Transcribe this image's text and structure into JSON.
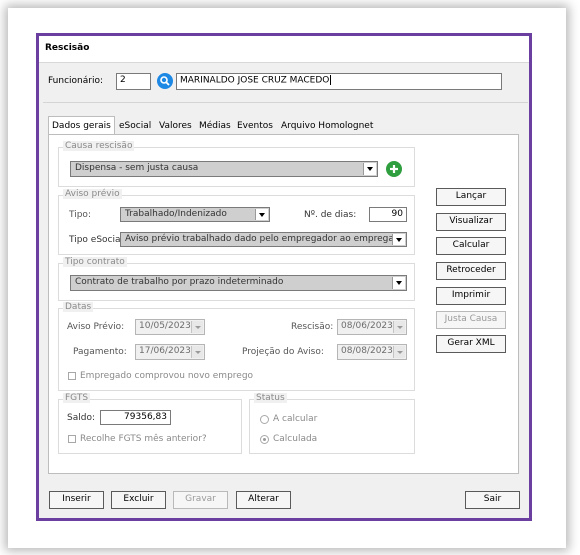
{
  "window": {
    "title": "Rescisão"
  },
  "funcionario": {
    "label": "Funcionário:",
    "code": "2",
    "name": "MARINALDO JOSE CRUZ MACEDO"
  },
  "tabs": [
    {
      "label": "Dados gerais",
      "active": true
    },
    {
      "label": "eSocial"
    },
    {
      "label": "Valores"
    },
    {
      "label": "Médias"
    },
    {
      "label": "Eventos"
    },
    {
      "label": "Arquivo Homolognet"
    }
  ],
  "causa": {
    "group_title": "Causa rescisão",
    "value": "Dispensa - sem justa causa"
  },
  "aviso": {
    "group_title": "Aviso prévio",
    "tipo_label": "Tipo:",
    "tipo_value": "Trabalhado/Indenizado",
    "dias_label": "Nº. de dias:",
    "dias_value": "90",
    "esocial_label": "Tipo eSocial:",
    "esocial_value": "Aviso prévio trabalhado dado pelo empregador ao empregado, ..."
  },
  "contrato": {
    "group_title": "Tipo contrato",
    "value": "Contrato de trabalho por prazo indeterminado"
  },
  "datas": {
    "group_title": "Datas",
    "aviso_label": "Aviso Prévio:",
    "aviso_value": "10/05/2023",
    "rescisao_label": "Rescisão:",
    "rescisao_value": "08/06/2023",
    "pagamento_label": "Pagamento:",
    "pagamento_value": "17/06/2023",
    "projecao_label": "Projeção do Aviso:",
    "projecao_value": "08/08/2023",
    "empregado_label": "Empregado comprovou novo emprego"
  },
  "fgts": {
    "group_title": "FGTS",
    "saldo_label": "Saldo:",
    "saldo_value": "79356,83",
    "recolhe_label": "Recolhe FGTS mês anterior?"
  },
  "status": {
    "group_title": "Status",
    "a_calcular": "A calcular",
    "calculada": "Calculada",
    "selected": "Calculada"
  },
  "side_buttons": {
    "lancar": "Lançar",
    "visualizar": "Visualizar",
    "calcular": "Calcular",
    "retroceder": "Retroceder",
    "imprimir": "Imprimir",
    "justa_causa": "Justa Causa",
    "gerar_xml": "Gerar XML"
  },
  "bottom_buttons": {
    "inserir": "Inserir",
    "excluir": "Excluir",
    "gravar": "Gravar",
    "alterar": "Alterar",
    "sair": "Sair"
  },
  "colors": {
    "frame_border": "#6b3fa0",
    "search_icon": "#1e88e5",
    "add_icon": "#2e9e3e"
  }
}
